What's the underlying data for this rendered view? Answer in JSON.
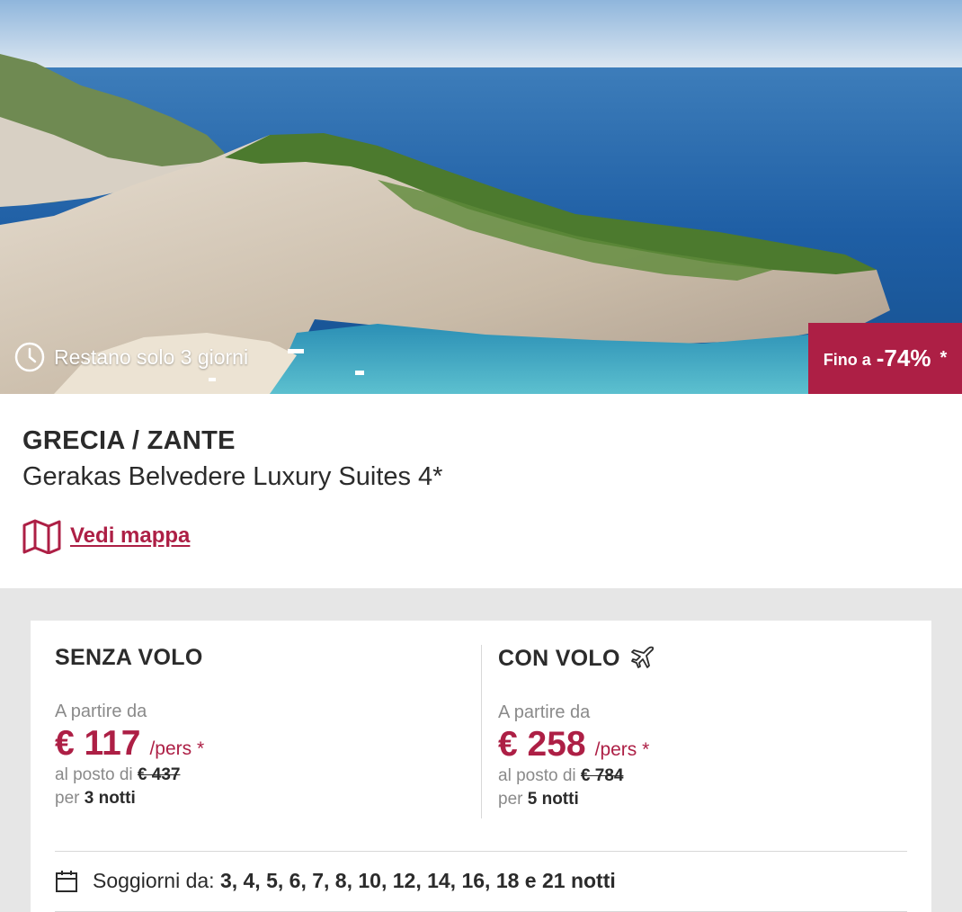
{
  "hero": {
    "countdown_text": "Restano solo 3 giorni",
    "badge": {
      "prefix": "Fino a",
      "percent": "-74%",
      "asterisk": "*"
    }
  },
  "header": {
    "destination": "GRECIA / ZANTE",
    "hotel_name": "Gerakas Belvedere Luxury Suites 4*",
    "map_link": "Vedi mappa"
  },
  "offers": {
    "without_flight": {
      "title": "SENZA VOLO",
      "from_label": "A partire da",
      "price": "€ 117",
      "per_person": "/pers *",
      "instead_of_label": "al posto di",
      "old_price": "€ 437",
      "for_label": "per",
      "nights": "3 notti"
    },
    "with_flight": {
      "title": "CON VOLO",
      "from_label": "A partire da",
      "price": "€ 258",
      "per_person": "/pers *",
      "instead_of_label": "al posto di",
      "old_price": "€ 784",
      "for_label": "per",
      "nights": "5 notti"
    }
  },
  "stays": {
    "label": "Soggiorni da:",
    "values": "3, 4, 5, 6, 7, 8, 10, 12, 14, 16, 18 e 21 notti"
  },
  "colors": {
    "accent": "#ad1f45",
    "text": "#2b2b2b",
    "muted": "#8a8a8a",
    "section_bg": "#e6e6e6"
  },
  "icons": [
    "clock-icon",
    "map-icon",
    "airplane-icon",
    "calendar-icon"
  ]
}
